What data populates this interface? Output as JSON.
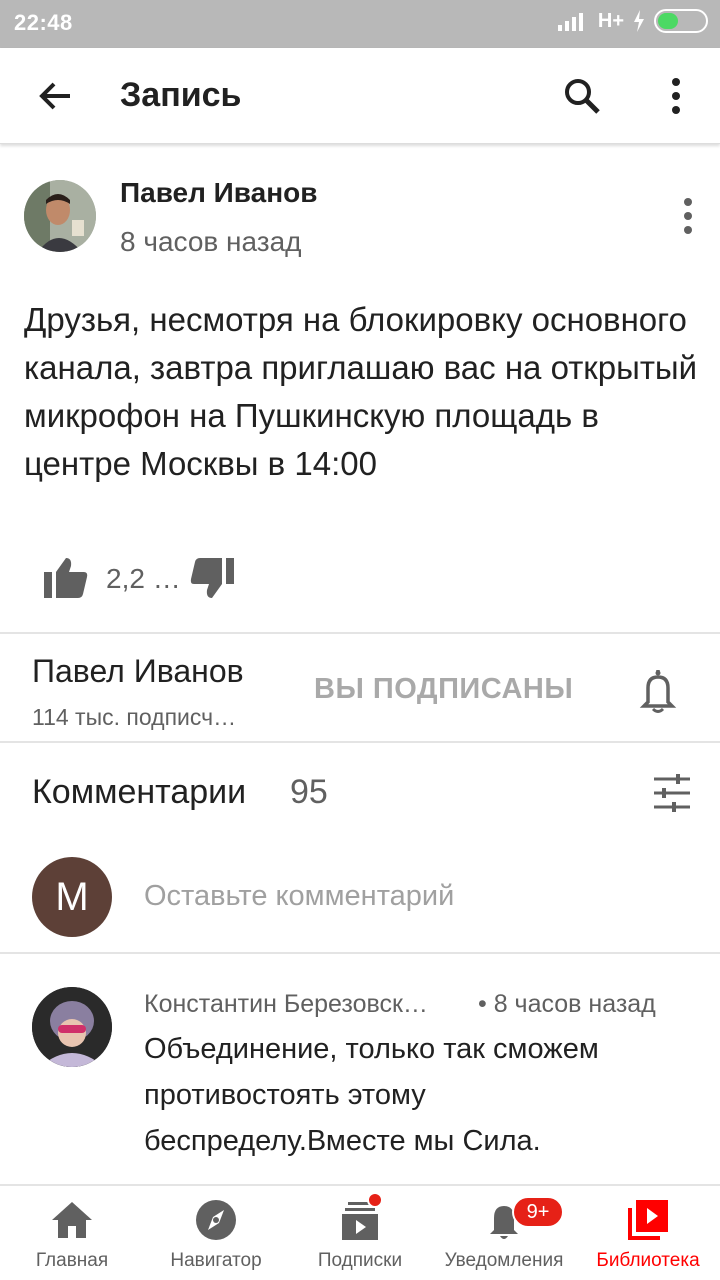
{
  "status": {
    "time": "22:48",
    "network": "H+"
  },
  "appbar": {
    "title": "Запись"
  },
  "post": {
    "author": "Павел Иванов",
    "time": "8 часов назад",
    "text": "Друзья, несмотря на блокировку основного канала, завтра приглашаю вас на открытый микрофон на Пушкинскую площадь в центре Москвы в 14:00",
    "likes": "2,2 …"
  },
  "channel": {
    "name": "Павел Иванов",
    "subscribers": "114 тыс. подписч…",
    "subscribe_state": "ВЫ ПОДПИСАНЫ"
  },
  "comments": {
    "title": "Комментарии",
    "count": "95",
    "my_avatar_letter": "М",
    "input_placeholder": "Оставьте комментарий",
    "items": [
      {
        "author": "Константин Березовск…",
        "time": "• 8 часов назад",
        "text": "Объединение, только так сможем противостоять этому беспределу.Вместе мы Сила."
      }
    ]
  },
  "bottom_nav": {
    "items": [
      {
        "label": "Главная",
        "icon": "home-icon"
      },
      {
        "label": "Навигатор",
        "icon": "compass-icon"
      },
      {
        "label": "Подписки",
        "icon": "subscriptions-icon"
      },
      {
        "label": "Уведомления",
        "icon": "bell-icon"
      },
      {
        "label": "Библиотека",
        "icon": "library-icon"
      }
    ],
    "notification_badge": "9+"
  },
  "colors": {
    "accent": "#ff0000",
    "badge": "#e62117",
    "avatar_me": "#5d4037"
  }
}
